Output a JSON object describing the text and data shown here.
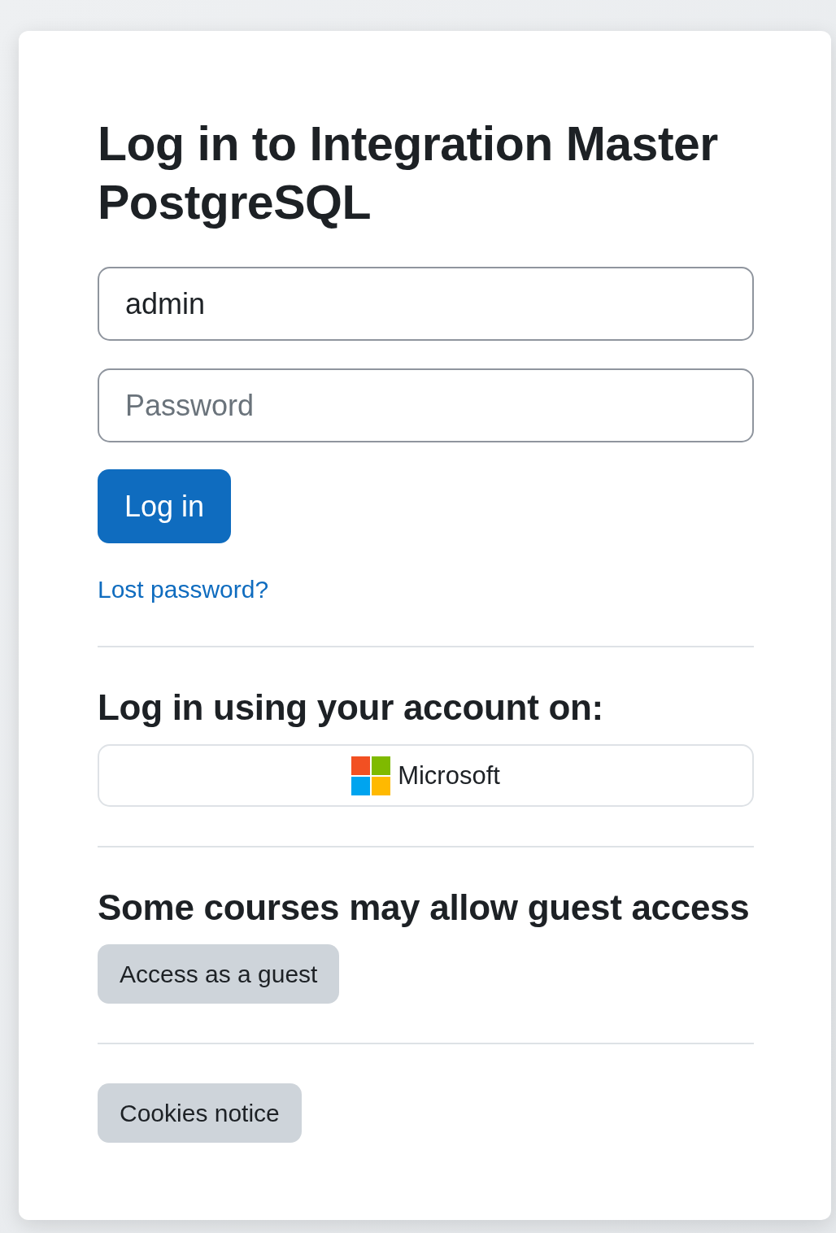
{
  "title": "Log in to Integration Master PostgreSQL",
  "form": {
    "username": {
      "value": "admin"
    },
    "password": {
      "placeholder": "Password"
    },
    "login_button": "Log in",
    "lost_password_link": "Lost password?"
  },
  "identity_providers": {
    "heading": "Log in using your account on:",
    "providers": [
      {
        "label": "Microsoft"
      }
    ]
  },
  "guest": {
    "heading": "Some courses may allow guest access",
    "button": "Access as a guest"
  },
  "footer": {
    "cookies_button": "Cookies notice"
  }
}
